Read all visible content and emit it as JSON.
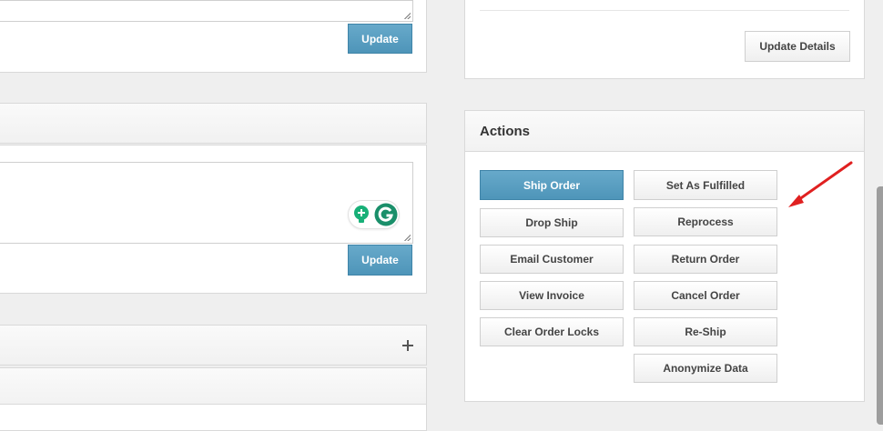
{
  "left_column": {
    "top_update_button_label": "Update",
    "middle_update_button_label": "Update"
  },
  "details_panel": {
    "update_details_label": "Update Details"
  },
  "actions_panel": {
    "title": "Actions",
    "buttons": {
      "ship_order": "Ship Order",
      "set_as_fulfilled": "Set As Fulfilled",
      "drop_ship": "Drop Ship",
      "reprocess": "Reprocess",
      "email_customer": "Email Customer",
      "return_order": "Return Order",
      "view_invoice": "View Invoice",
      "cancel_order": "Cancel Order",
      "clear_order_locks": "Clear Order Locks",
      "re_ship": "Re-Ship",
      "anonymize_data": "Anonymize Data"
    }
  },
  "icons": {
    "expand": "plus-icon",
    "grammarly_hint": "lightbulb-plus-icon",
    "grammarly_logo": "grammarly-g-icon",
    "annotation": "red-arrow-icon"
  },
  "colors": {
    "page_bg": "#efefef",
    "panel_bg": "#ffffff",
    "primary_button": "#5a9fc1",
    "annotation_arrow": "#e02020",
    "grammarly_green": "#18b078"
  }
}
